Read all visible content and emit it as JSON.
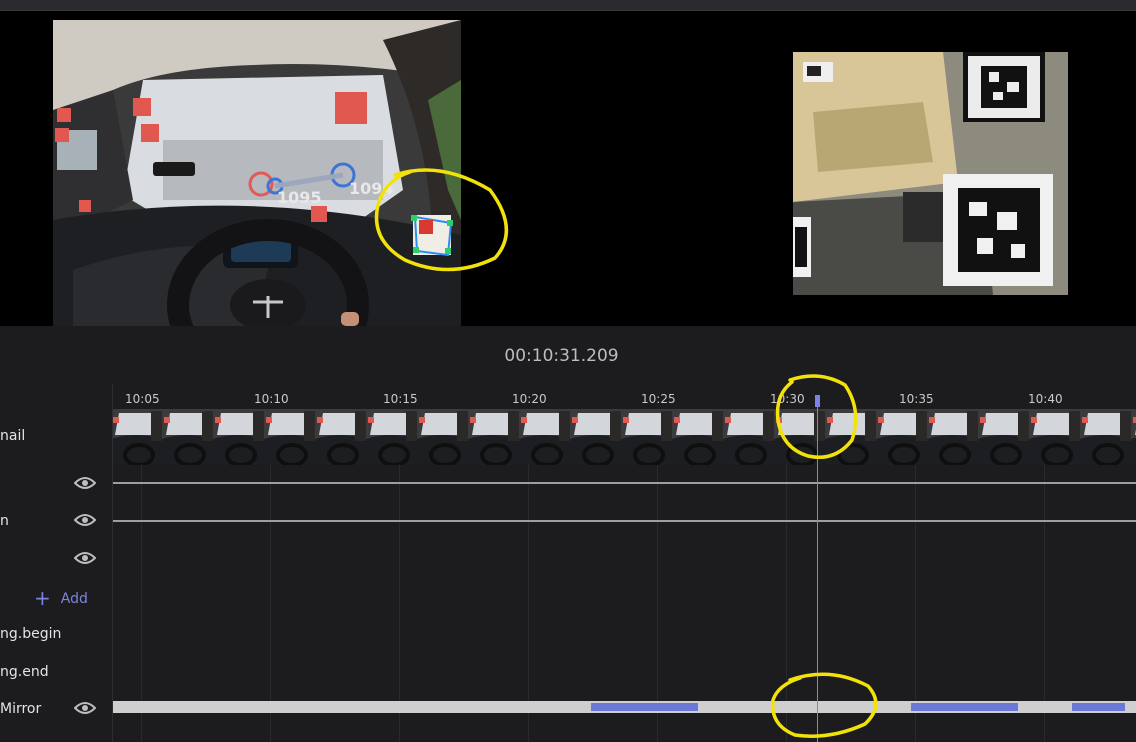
{
  "player": {
    "timecode": "00:10:31.209",
    "annotations": [
      "1095",
      "1094"
    ]
  },
  "timeline": {
    "ticks": [
      "10:05",
      "10:10",
      "10:15",
      "10:20",
      "10:25",
      "10:30",
      "10:35",
      "10:40"
    ],
    "tracks": {
      "thumbnail": "nail",
      "track_2": "n",
      "add_label": "Add",
      "begin": "ng.begin",
      "end": "ng.end",
      "mirror": "Mirror"
    },
    "playhead_time": "10:31.209"
  },
  "colors": {
    "accent": "#7b83e6",
    "segment": "#6b78d8",
    "highlight": "#f2e20a"
  }
}
